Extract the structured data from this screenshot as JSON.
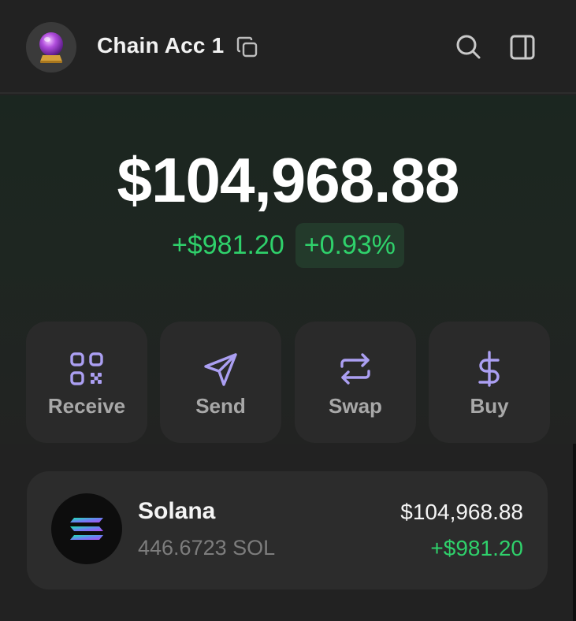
{
  "header": {
    "account_name": "Chain Acc 1",
    "avatar_icon": "crystal-ball-icon",
    "icons": [
      "copy-icon",
      "search-icon",
      "side-panel-icon"
    ]
  },
  "portfolio": {
    "balance": "$104,968.88",
    "change_abs": "+$981.20",
    "change_pct": "+0.93%"
  },
  "actions": [
    {
      "label": "Receive",
      "icon": "qr-code-icon"
    },
    {
      "label": "Send",
      "icon": "send-icon"
    },
    {
      "label": "Swap",
      "icon": "swap-icon"
    },
    {
      "label": "Buy",
      "icon": "dollar-icon"
    }
  ],
  "tokens": [
    {
      "name": "Solana",
      "amount": "446.6723 SOL",
      "value": "$104,968.88",
      "change": "+$981.20",
      "icon": "solana-logo-icon"
    }
  ],
  "colors": {
    "background": "#222222",
    "positive": "#2fd16b",
    "accent": "#ab9ff2"
  }
}
